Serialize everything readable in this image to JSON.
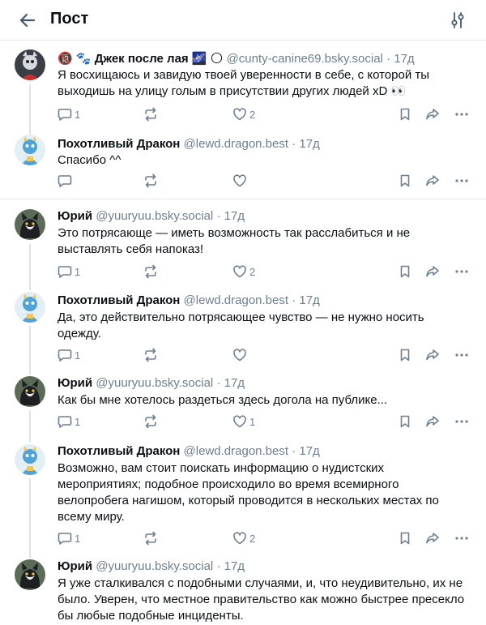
{
  "header": {
    "title": "Пост"
  },
  "icons": {
    "back": "arrow-left-icon",
    "filter": "sliders-icon",
    "reply": "comment-icon",
    "repost": "repost-icon",
    "like": "heart-icon",
    "save": "bookmark-icon",
    "share": "share-icon",
    "more": "ellipsis-icon"
  },
  "colors": {
    "muted": "#6e7f91",
    "text": "#0b0f14",
    "divider": "#e6ebf0"
  },
  "posts": [
    {
      "emoji_prefix": "🔞 🐾",
      "name": "Джек после лая",
      "name_suffix": "🌌 🌕",
      "handle": "@cunty-canine69.bsky.social",
      "sep": "·",
      "time": "17д",
      "text": "Я восхищаюсь и завидую твоей уверенности в себе, с которой ты выходишь на улицу голым в присутствии других людей xD 👀",
      "replies": "1",
      "reposts": "",
      "likes": "2"
    },
    {
      "name": "Похотливый Дракон",
      "handle": "@lewd.dragon.best",
      "sep": "·",
      "time": "17д",
      "text": "Спасибо ^^",
      "replies": "",
      "reposts": "",
      "likes": ""
    },
    {
      "name": "Юрий",
      "handle": "@yuuryuu.bsky.social",
      "sep": "·",
      "time": "17д",
      "text": "Это потрясающе — иметь возможность так расслабиться и не выставлять себя напоказ!",
      "replies": "1",
      "reposts": "",
      "likes": "2"
    },
    {
      "name": "Похотливый Дракон",
      "handle": "@lewd.dragon.best",
      "sep": "·",
      "time": "17д",
      "text": "Да, это действительно потрясающее чувство — не нужно носить одежду.",
      "replies": "1",
      "reposts": "",
      "likes": ""
    },
    {
      "name": "Юрий",
      "handle": "@yuuryuu.bsky.social",
      "sep": "·",
      "time": "17д",
      "text": "Как бы мне хотелось раздеться здесь догола на публике...",
      "replies": "1",
      "reposts": "",
      "likes": "1"
    },
    {
      "name": "Похотливый Дракон",
      "handle": "@lewd.dragon.best",
      "sep": "·",
      "time": "17д",
      "text": "Возможно, вам стоит поискать информацию о нудистских мероприятиях; подобное происходило во время всемирного велопробега нагишом, который проводится в нескольких местах по всему миру.",
      "replies": "1",
      "reposts": "",
      "likes": "2"
    },
    {
      "name": "Юрий",
      "handle": "@yuuryuu.bsky.social",
      "sep": "·",
      "time": "17д",
      "text": "Я уже сталкивался с подобными случаями, и, что неудивительно, их не было. Уверен, что местное правительство как можно быстрее пресекло бы любые подобные инциденты."
    }
  ]
}
